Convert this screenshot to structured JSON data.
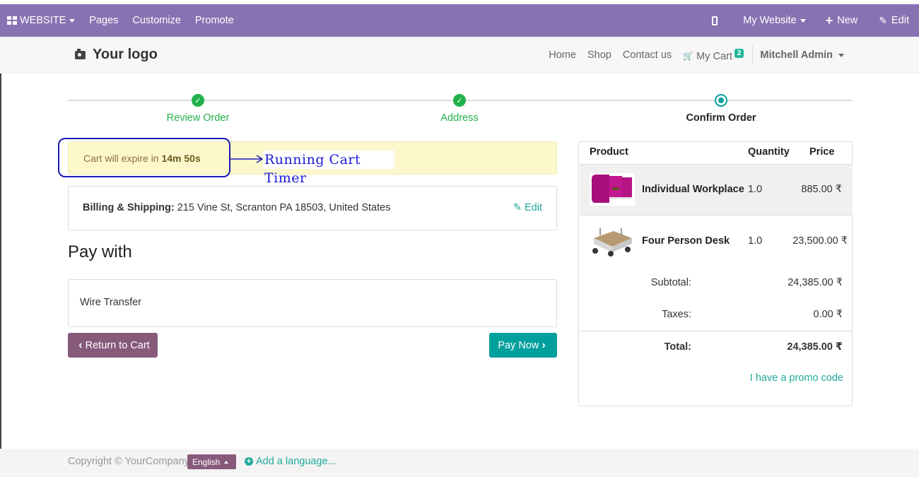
{
  "admin_bar": {
    "website_label": "WEBSITE",
    "pages_label": "Pages",
    "customize_label": "Customize",
    "promote_label": "Promote",
    "my_website_label": "My Website",
    "new_label": "New",
    "edit_label": "Edit",
    "color": "#8872b2"
  },
  "site_header": {
    "logo_text": "Your logo",
    "nav": [
      "Home",
      "Shop",
      "Contact us"
    ],
    "cart_label": "My Cart",
    "cart_count": "2",
    "user_name": "Mitchell Admin"
  },
  "steps": [
    {
      "label": "Review Order",
      "state": "done"
    },
    {
      "label": "Address",
      "state": "done"
    },
    {
      "label": "Confirm Order",
      "state": "current"
    }
  ],
  "cart_alert": {
    "prefix": "Cart will expire in",
    "timer": "14m 50s",
    "annotation": "Running Cart Timer"
  },
  "billing": {
    "label": "Billing & Shipping:",
    "address": "215 Vine St, Scranton PA 18503, United States",
    "edit_label": "Edit"
  },
  "payment": {
    "title": "Pay with",
    "method": "Wire Transfer",
    "return_label": "Return to Cart",
    "pay_label": "Pay Now"
  },
  "summary": {
    "headers": {
      "product": "Product",
      "quantity": "Quantity",
      "price": "Price"
    },
    "items": [
      {
        "name": "Individual Workplace",
        "qty": "1.0",
        "price": "885.00 ₹"
      },
      {
        "name": "Four Person Desk",
        "qty": "1.0",
        "price": "23,500.00 ₹"
      }
    ],
    "subtotal_label": "Subtotal:",
    "subtotal": "24,385.00 ₹",
    "taxes_label": "Taxes:",
    "taxes": "0.00 ₹",
    "total_label": "Total:",
    "total": "24,385.00 ₹",
    "promo_label": "I have a promo code"
  },
  "footer": {
    "copyright": "Copyright © YourCompany",
    "language": "English",
    "add_language": "Add a language..."
  }
}
